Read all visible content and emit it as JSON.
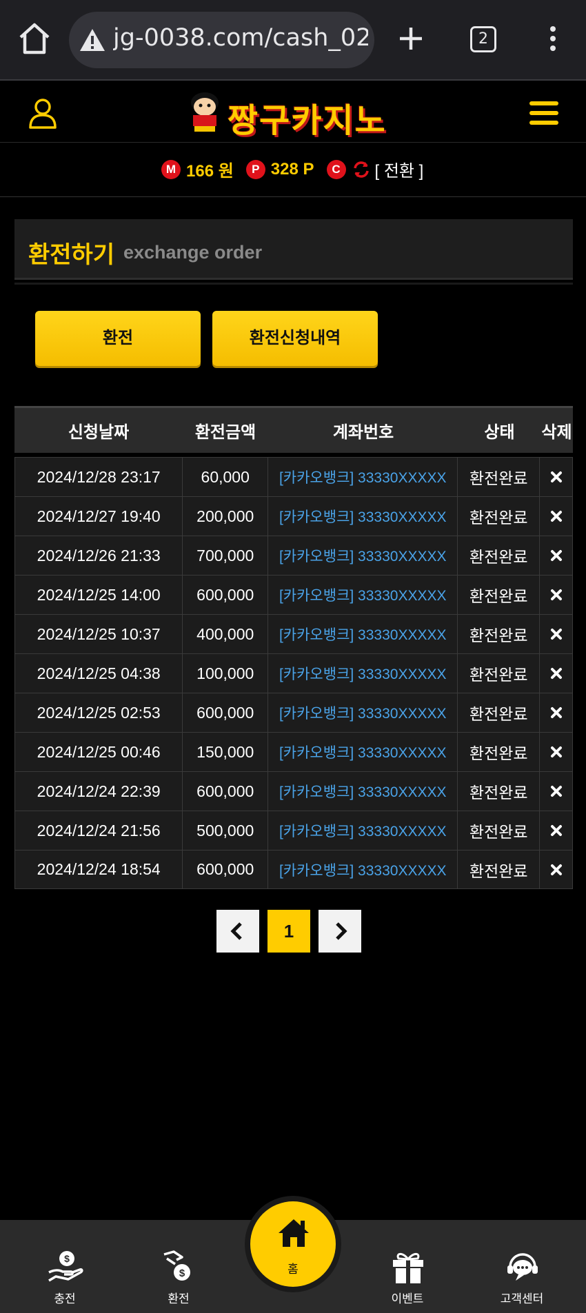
{
  "browser": {
    "url": "jg-0038.com/cash_02",
    "tab_count": "2",
    "icons": [
      "home-icon",
      "warning-icon",
      "plus-icon",
      "tabs-icon",
      "kebab-menu-icon"
    ]
  },
  "header": {
    "logo_text": "짱구카지노",
    "icons": [
      "user-icon",
      "hamburger-menu-icon"
    ]
  },
  "balance": {
    "money_badge": "M",
    "money_value": "166 원",
    "point_badge": "P",
    "point_value": "328 P",
    "casino_badge": "C",
    "convert_label": "[ 전환 ]"
  },
  "page_title": {
    "ko": "환전하기",
    "en": "exchange order"
  },
  "buttons": {
    "exchange": "환전",
    "history": "환전신청내역"
  },
  "table": {
    "headers": [
      "신청날짜",
      "환전금액",
      "계좌번호",
      "상태",
      "삭제"
    ],
    "rows": [
      {
        "date": "2024/12/28 23:17",
        "amount": "60,000",
        "account": "[카카오뱅크] 33330XXXXX",
        "status": "환전완료"
      },
      {
        "date": "2024/12/27 19:40",
        "amount": "200,000",
        "account": "[카카오뱅크] 33330XXXXX",
        "status": "환전완료"
      },
      {
        "date": "2024/12/26 21:33",
        "amount": "700,000",
        "account": "[카카오뱅크] 33330XXXXX",
        "status": "환전완료"
      },
      {
        "date": "2024/12/25 14:00",
        "amount": "600,000",
        "account": "[카카오뱅크] 33330XXXXX",
        "status": "환전완료"
      },
      {
        "date": "2024/12/25 10:37",
        "amount": "400,000",
        "account": "[카카오뱅크] 33330XXXXX",
        "status": "환전완료"
      },
      {
        "date": "2024/12/25 04:38",
        "amount": "100,000",
        "account": "[카카오뱅크] 33330XXXXX",
        "status": "환전완료"
      },
      {
        "date": "2024/12/25 02:53",
        "amount": "600,000",
        "account": "[카카오뱅크] 33330XXXXX",
        "status": "환전완료"
      },
      {
        "date": "2024/12/25 00:46",
        "amount": "150,000",
        "account": "[카카오뱅크] 33330XXXXX",
        "status": "환전완료"
      },
      {
        "date": "2024/12/24 22:39",
        "amount": "600,000",
        "account": "[카카오뱅크] 33330XXXXX",
        "status": "환전완료"
      },
      {
        "date": "2024/12/24 21:56",
        "amount": "500,000",
        "account": "[카카오뱅크] 33330XXXXX",
        "status": "환전완료"
      },
      {
        "date": "2024/12/24 18:54",
        "amount": "600,000",
        "account": "[카카오뱅크] 33330XXXXX",
        "status": "환전완료"
      }
    ]
  },
  "pagination": {
    "current_page": "1"
  },
  "bottom_nav": {
    "charge": "충전",
    "exchange": "환전",
    "home": "홈",
    "event": "이벤트",
    "support": "고객센터"
  },
  "colors": {
    "accent": "#ffcc00",
    "background": "#000000",
    "link": "#4aa3e8",
    "badge": "#e0121b"
  }
}
